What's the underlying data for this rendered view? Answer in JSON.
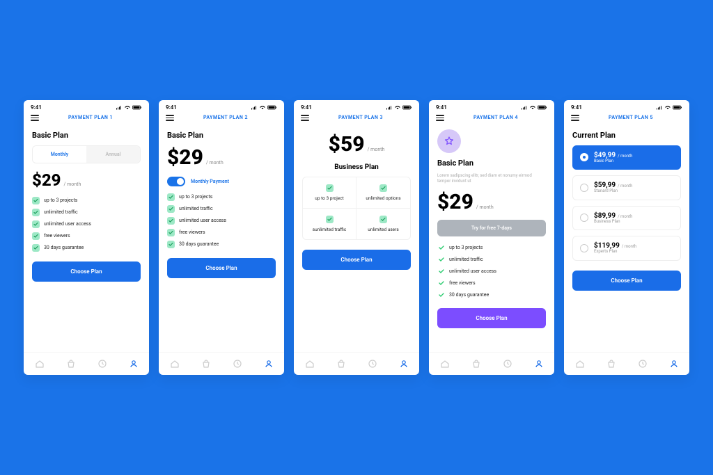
{
  "status": {
    "time": "9:41"
  },
  "screens": [
    {
      "header": "PAYMENT PLAN 1",
      "title": "Basic Plan",
      "segmented": {
        "monthly": "Monthly",
        "annual": "Annual"
      },
      "price": "$29",
      "per": "/ month",
      "features": [
        "up to 3 projects",
        "unlimited traffic",
        "unlimited user access",
        "free viewers",
        "30 days guarantee"
      ],
      "cta": "Choose Plan"
    },
    {
      "header": "PAYMENT PLAN 2",
      "title": "Basic Plan",
      "price": "$29",
      "per": "/ month",
      "toggle_label": "Monthly Payment",
      "features": [
        "up to 3 projects",
        "unlimited traffic",
        "unlimited user access",
        "free viewers",
        "30 days guarantee"
      ],
      "cta": "Choose Plan"
    },
    {
      "header": "PAYMENT PLAN 3",
      "price": "$59",
      "per": "/ month",
      "subtitle": "Business Plan",
      "grid": [
        "up to 3 project",
        "unlimited options",
        "sunlimited traffic",
        "unlimited users"
      ],
      "cta": "Choose Plan"
    },
    {
      "header": "PAYMENT PLAN 4",
      "title": "Basic Plan",
      "desc": "Lorem sadipscing elitr, sed diam et nonumy eirmod tempor invidunt ut",
      "price": "$29",
      "per": "/ month",
      "trial_cta": "Try for free 7-days",
      "features": [
        "up to 3 projects",
        "unlimited traffic",
        "unlimited user access",
        "free viewers",
        "30 days guarantee"
      ],
      "cta": "Choose Plan"
    },
    {
      "header": "PAYMENT PLAN 5",
      "title": "Current Plan",
      "options": [
        {
          "price": "$49,99",
          "per": "/ month",
          "name": "Basic Plan",
          "active": true
        },
        {
          "price": "$59,99",
          "per": "/ month",
          "name": "Stanard Plan",
          "active": false
        },
        {
          "price": "$89,99",
          "per": "/ month",
          "name": "Business Plan",
          "active": false
        },
        {
          "price": "$119,99",
          "per": "/ month",
          "name": "Experts Plan",
          "active": false
        }
      ],
      "cta": "Choose Plan"
    }
  ]
}
